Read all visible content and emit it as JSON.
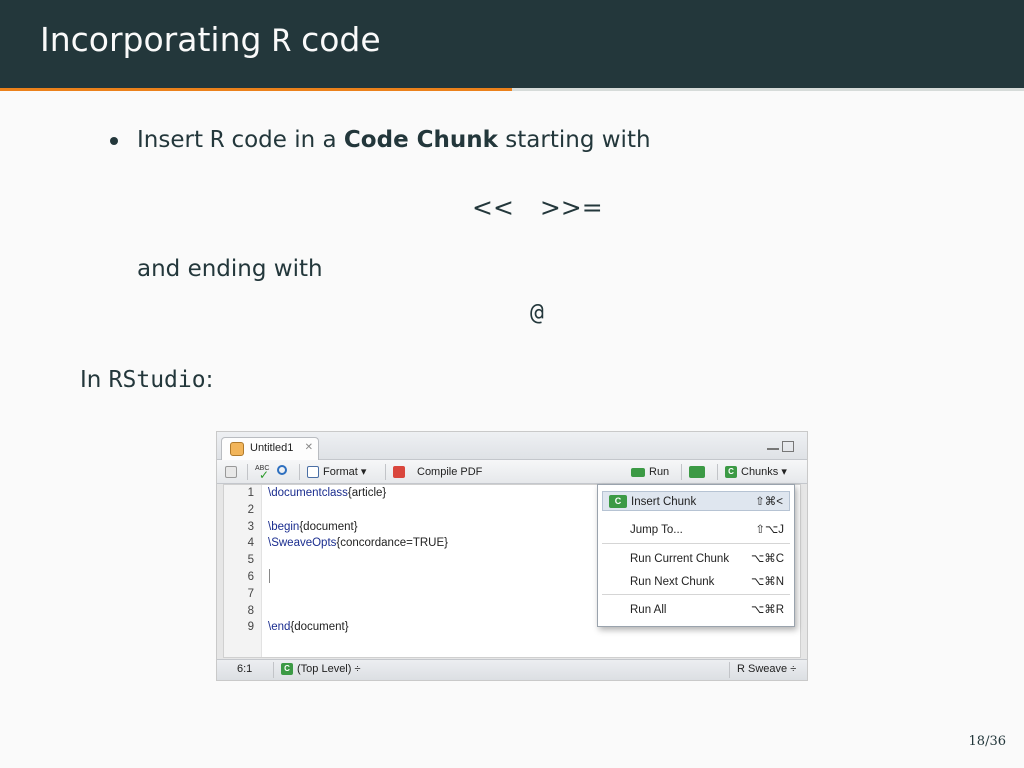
{
  "slide": {
    "title_prefix": "Incorporating ",
    "title_code": "R",
    "title_suffix": " code",
    "progress_fraction": 0.5,
    "page_number": "18/36",
    "colors": {
      "header": "#23373b",
      "accent": "#eb811b",
      "background": "#fafafa"
    }
  },
  "body": {
    "bullet1": {
      "prefix": "Insert ",
      "code": "R",
      "middle": " code in a ",
      "bold": "Code Chunk",
      "suffix": " starting with"
    },
    "display_start": "<< >>=",
    "line2": "and ending with",
    "display_end": "@",
    "line3_prefix": "In ",
    "line3_code": "RStudio",
    "line3_suffix": ":"
  },
  "rstudio": {
    "tab_label": "Untitled1",
    "toolbar": {
      "spell_label": "ABC",
      "format_label": "Format",
      "compile_label": "Compile PDF",
      "run_label": "Run",
      "chunks_label": "Chunks",
      "chunks_icon_letter": "C"
    },
    "lines": [
      {
        "num": "1",
        "kw": "\\documentclass",
        "arg": "{article}"
      },
      {
        "num": "2",
        "kw": "",
        "arg": ""
      },
      {
        "num": "3",
        "kw": "\\begin",
        "arg": "{document}"
      },
      {
        "num": "4",
        "kw": "\\SweaveOpts",
        "arg": "{concordance=TRUE}"
      },
      {
        "num": "5",
        "kw": "",
        "arg": ""
      },
      {
        "num": "6",
        "kw": "",
        "arg": ""
      },
      {
        "num": "7",
        "kw": "",
        "arg": ""
      },
      {
        "num": "8",
        "kw": "",
        "arg": ""
      },
      {
        "num": "9",
        "kw": "\\end",
        "arg": "{document}"
      }
    ],
    "menu": [
      {
        "label": "Insert Chunk",
        "key": "⇧⌘<"
      },
      {
        "label": "Jump To...",
        "key": "⇧⌥J"
      },
      {
        "label": "Run Current Chunk",
        "key": "⌥⌘C"
      },
      {
        "label": "Run Next Chunk",
        "key": "⌥⌘N"
      },
      {
        "label": "Run All",
        "key": "⌥⌘R"
      }
    ],
    "status": {
      "position": "6:1",
      "scope": "(Top Level) ÷",
      "mode": "R Sweave ÷",
      "scope_icon_letter": "C"
    }
  }
}
